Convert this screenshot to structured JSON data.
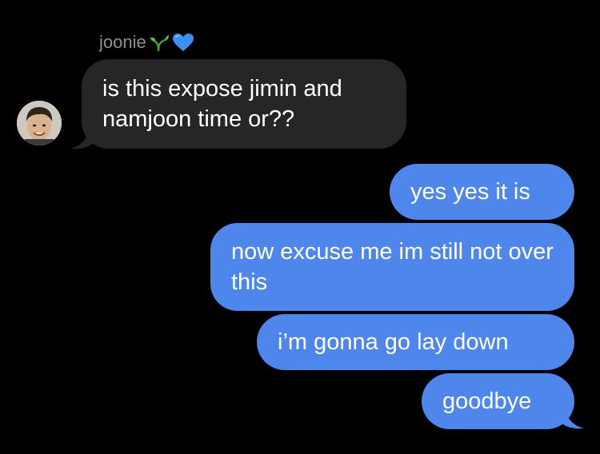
{
  "conversation": {
    "contact_name": "joonie",
    "contact_emojis": [
      "seedling-emoji",
      "blue-heart-emoji"
    ],
    "messages": [
      {
        "direction": "incoming",
        "text": "is this expose jimin and namjoon time or??"
      },
      {
        "direction": "outgoing",
        "text": "yes yes it is"
      },
      {
        "direction": "outgoing",
        "text": "now excuse me im still not over this"
      },
      {
        "direction": "outgoing",
        "text": "i’m gonna go lay down"
      },
      {
        "direction": "outgoing",
        "text": "goodbye"
      }
    ]
  },
  "colors": {
    "background": "#000000",
    "incoming_bubble": "#262629",
    "outgoing_bubble": "#4f86ec",
    "sender_name": "#8e8e93",
    "text": "#ffffff"
  }
}
